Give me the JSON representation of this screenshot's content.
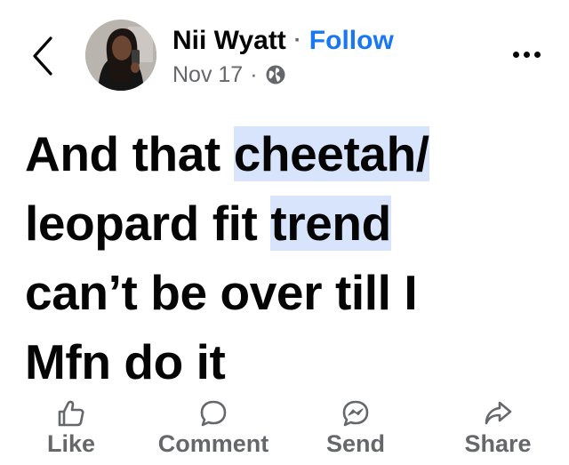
{
  "header": {
    "back_icon": "chevron-left-icon",
    "author_name": "Nii Wyatt",
    "separator": "·",
    "follow_label": "Follow",
    "date": "Nov 17",
    "meta_separator": "·",
    "privacy_icon": "globe-icon",
    "more_icon": "more-horizontal-icon"
  },
  "post": {
    "lines": [
      [
        "And that ",
        "cheetah/"
      ],
      [
        "leopard fit ",
        "trend"
      ],
      [
        "can’t be over till I",
        ""
      ],
      [
        "Mfn do it",
        ""
      ]
    ]
  },
  "actions": [
    {
      "icon": "thumbs-up-icon",
      "label": "Like"
    },
    {
      "icon": "comment-icon",
      "label": "Comment"
    },
    {
      "icon": "messenger-icon",
      "label": "Send"
    },
    {
      "icon": "share-icon",
      "label": "Share"
    }
  ],
  "colors": {
    "accent": "#1877f2",
    "secondary_text": "#65676b",
    "highlight": "#d7e4fb"
  }
}
